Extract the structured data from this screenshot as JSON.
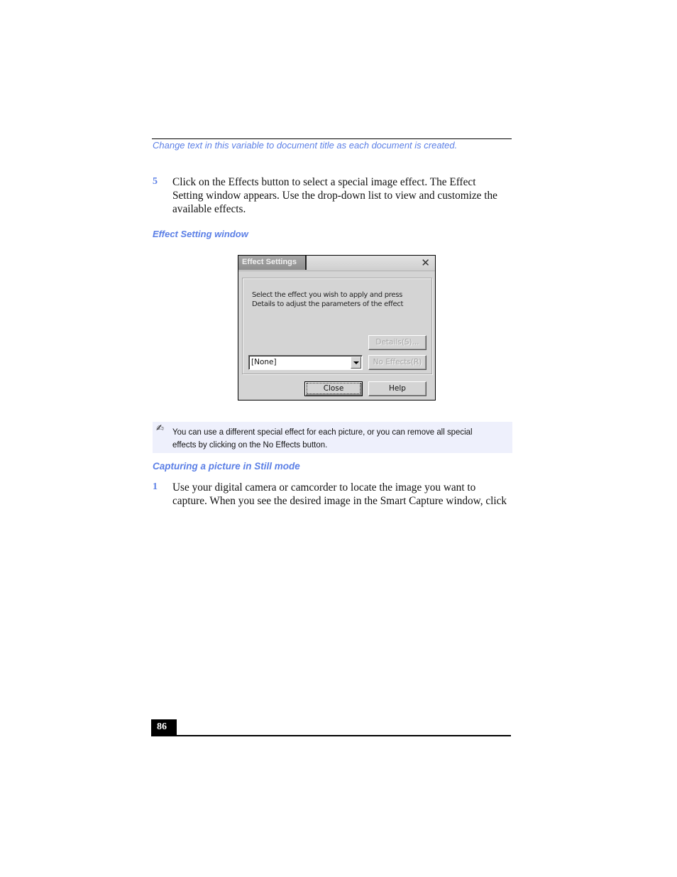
{
  "header": {
    "title": "Change text in this variable to document title as each document is created."
  },
  "steps": [
    {
      "number": "5",
      "lines": [
        "Click on the Effects button to select a special image effect. The Effect",
        "Setting window appears. Use the drop-down list to view and customize the",
        "available effects."
      ]
    }
  ],
  "figure": {
    "caption": "Effect Setting window",
    "dialog": {
      "title": "Effect Settings",
      "close_glyph": "✕",
      "instructions": [
        "Select the effect you wish to apply and press",
        "Details to adjust the parameters of the effect"
      ],
      "details_button": "Details(S)...",
      "no_effects_button": "No Effects(R)",
      "effect_select": {
        "selected": "[None]"
      },
      "close_button": "Close",
      "help_button": "Help"
    }
  },
  "note": {
    "icon": "✍",
    "text": "You can use a different special effect for each picture, or you can remove all special effects by clicking on the No Effects button."
  },
  "section": {
    "heading": "Capturing a picture in Still mode",
    "steps": [
      {
        "number": "1",
        "lines": [
          "Use your digital camera or camcorder to locate the image you want to",
          "capture. When you see the desired image in the Smart Capture window, click"
        ]
      }
    ]
  },
  "footer": {
    "page_number": "86"
  },
  "colors": {
    "accent": "#5b7fe6",
    "note_background": "#eef0fc"
  }
}
